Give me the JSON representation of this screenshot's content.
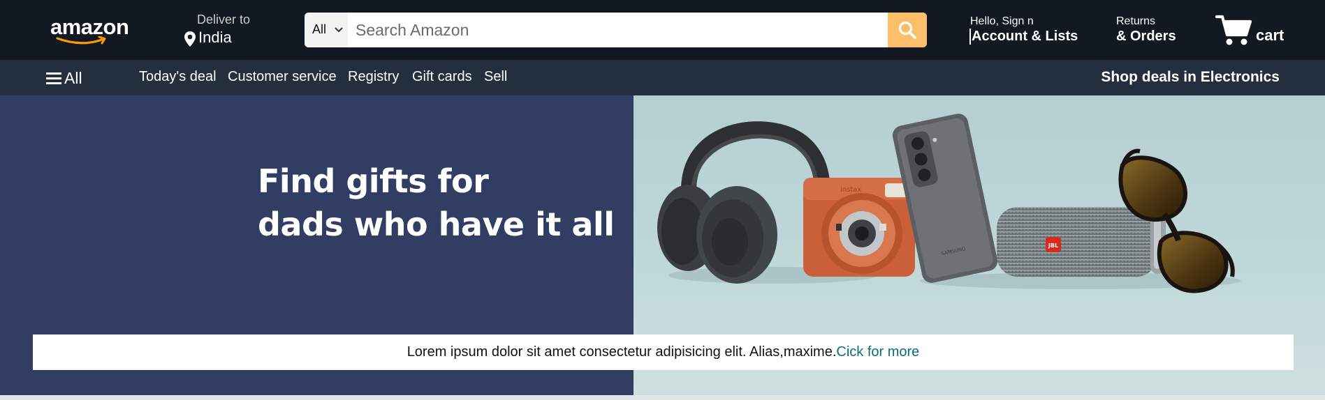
{
  "header": {
    "logo_text": "amazon",
    "deliver_label": "Deliver to",
    "deliver_location": "India",
    "search": {
      "category": "All",
      "placeholder": "Search Amazon"
    },
    "account": {
      "greeting": "Hello, Sign n",
      "label": "Account & Lists"
    },
    "returns": {
      "line1": "Returns",
      "line2": "& Orders"
    },
    "cart_label": "cart"
  },
  "subnav": {
    "all_label": "All",
    "links": [
      "Today's deal",
      "Customer service",
      "Registry",
      "Gift cards",
      "Sell"
    ],
    "promo": "Shop deals in Electronics"
  },
  "hero": {
    "title_line1": "Find gifts for",
    "title_line2": "dads who have it all",
    "banner_text": "Lorem ipsum dolor sit amet consectetur adipisicing elit. Alias,maxime.",
    "banner_link": "Cick for more",
    "camera_brand": "instax",
    "speaker_brand": "JBL",
    "phone_brand": "SAMSUNG"
  },
  "colors": {
    "nav_top": "#131921",
    "nav_sub": "#232f3e",
    "search_button": "#febd69",
    "hero_left": "#313d63",
    "hero_right": "#b4cfd1",
    "link": "#0b6b7e"
  }
}
